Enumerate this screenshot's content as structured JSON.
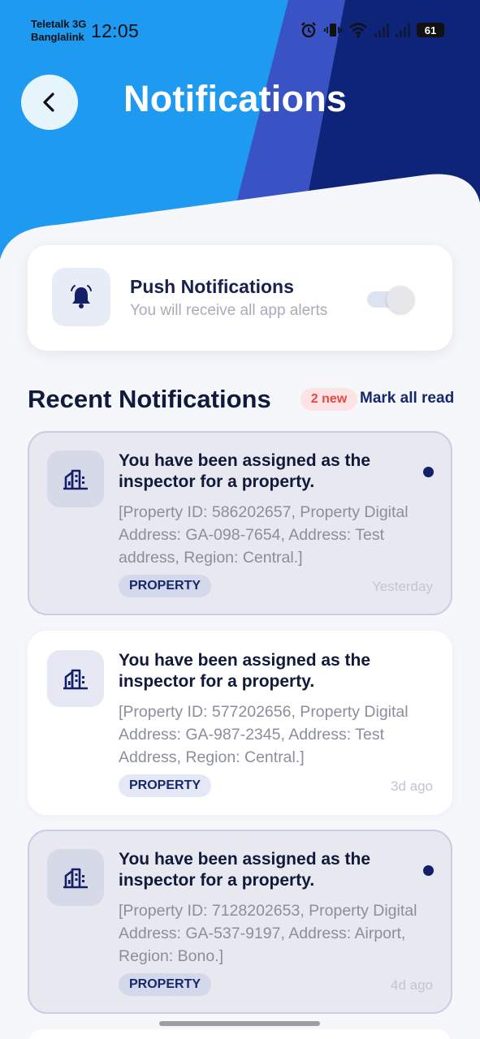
{
  "status_bar": {
    "carrier_line1": "Teletalk 3G",
    "carrier_line2": "Banglalink",
    "time": "12:05",
    "battery": "61"
  },
  "header": {
    "title": "Notifications",
    "back_icon": "chevron-left-icon"
  },
  "push": {
    "icon": "bell-icon",
    "title": "Push Notifications",
    "subtitle": "You will receive all app alerts",
    "enabled": false
  },
  "recent": {
    "title": "Recent Notifications",
    "badge": "2 new",
    "mark_all": "Mark all read"
  },
  "notifications": [
    {
      "icon": "building-icon",
      "title": "You have been assigned as the inspector for a property.",
      "body": "[Property ID: 586202657, Property Digital Address: GA-098-7654, Address: Test address, Region: Central.]",
      "tag": "PROPERTY",
      "time": "Yesterday",
      "unread": true
    },
    {
      "icon": "building-icon",
      "title": "You have been assigned as the inspector for a property.",
      "body": "[Property ID: 577202656, Property Digital Address: GA-987-2345, Address: Test Address, Region: Central.]",
      "tag": "PROPERTY",
      "time": "3d ago",
      "unread": false
    },
    {
      "icon": "building-icon",
      "title": "You have been assigned as the inspector for a property.",
      "body": "[Property ID: 7128202653, Property Digital Address: GA-537-9197, Address: Airport, Region: Bono.]",
      "tag": "PROPERTY",
      "time": "4d ago",
      "unread": true
    }
  ],
  "colors": {
    "header_light": "#1e9af0",
    "header_mid": "#3a53c4",
    "header_dark": "#0e2478",
    "accent": "#16286a",
    "unread_dot": "#131f66",
    "badge_text": "#e24a4a"
  }
}
